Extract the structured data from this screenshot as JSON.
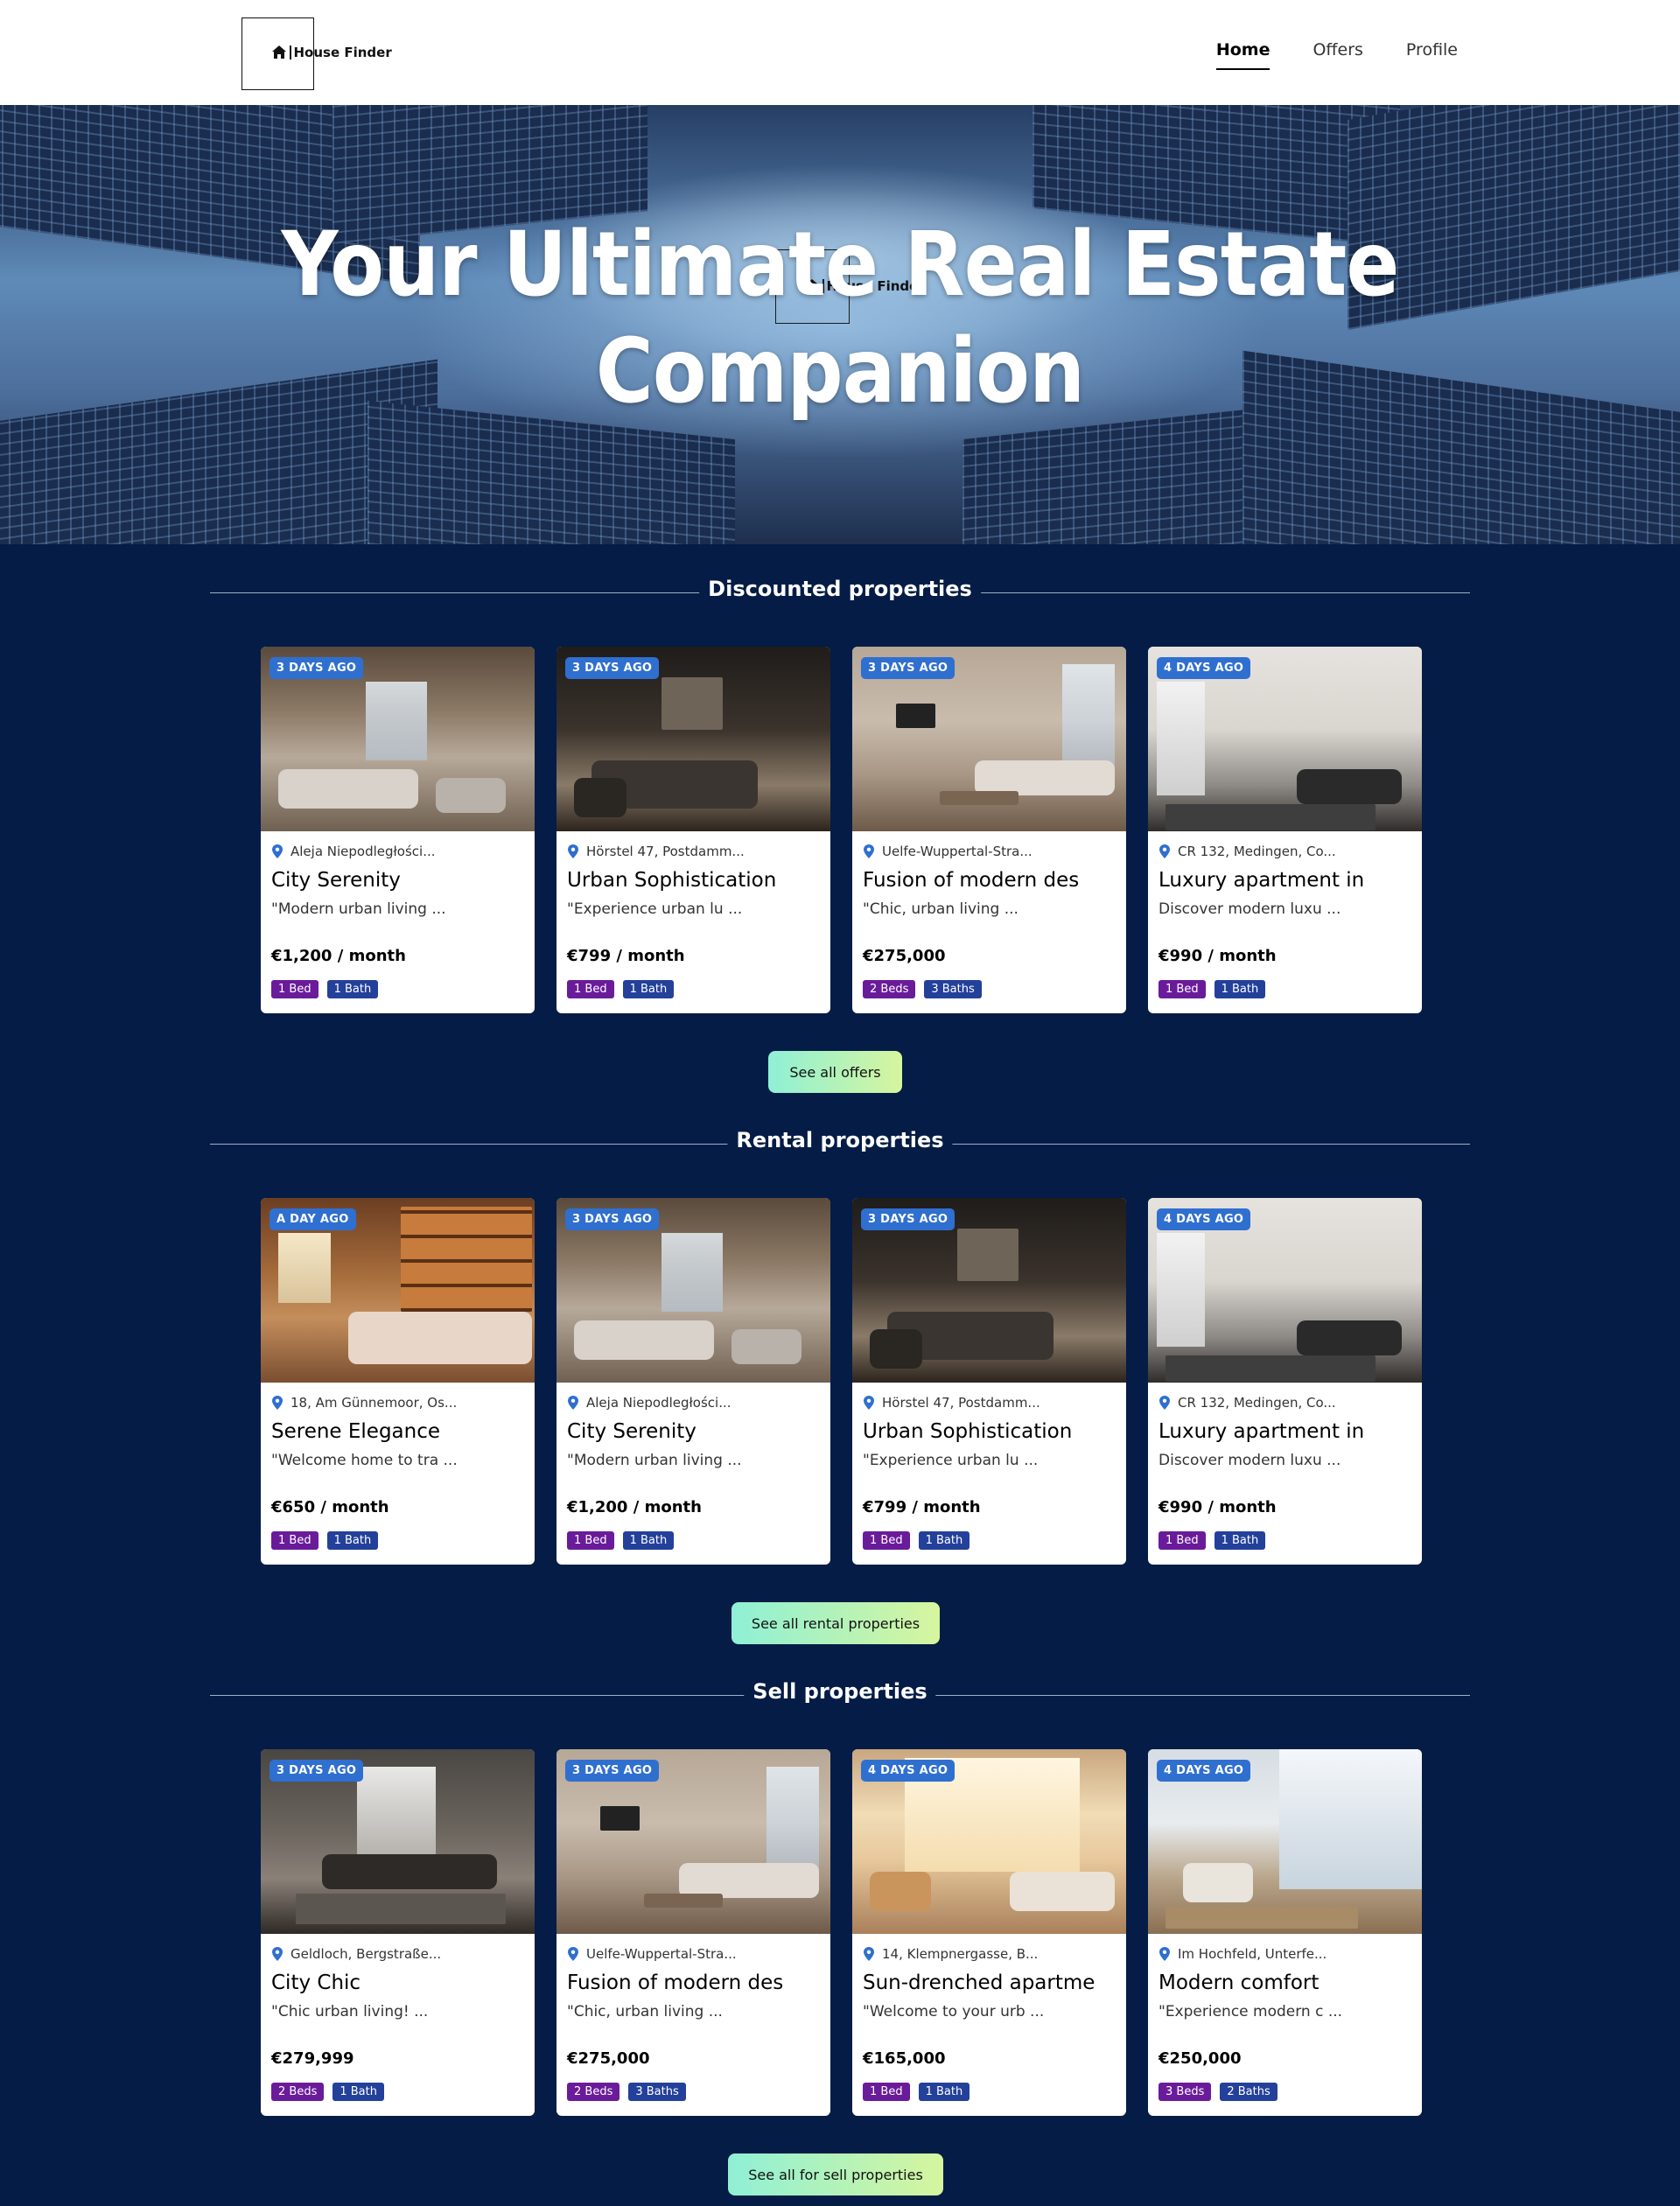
{
  "header": {
    "logo_text": "House Finder",
    "nav": [
      {
        "label": "Home",
        "active": true
      },
      {
        "label": "Offers",
        "active": false
      },
      {
        "label": "Profile",
        "active": false
      }
    ]
  },
  "hero": {
    "logo_text": "House Finder",
    "title": "Your Ultimate Real Estate Companion"
  },
  "sections": [
    {
      "title": "Discounted properties",
      "cta": "See all offers",
      "cards": [
        {
          "badge": "3 DAYS AGO",
          "location": "Aleja Niepodległości...",
          "name": "City Serenity",
          "desc": "\"Modern urban living ...",
          "price": "€1,200 / month",
          "beds": "1 Bed",
          "baths": "1 Bath",
          "scene": "bedroom1"
        },
        {
          "badge": "3 DAYS AGO",
          "location": "Hörstel 47, Postdamm...",
          "name": "Urban Sophistication",
          "desc": "\"Experience urban lu ...",
          "price": "€799 / month",
          "beds": "1 Bed",
          "baths": "1 Bath",
          "scene": "bedroom2"
        },
        {
          "badge": "3 DAYS AGO",
          "location": "Uelfe-Wuppertal-Stra...",
          "name": "Fusion of modern des",
          "desc": "\"Chic, urban living ...",
          "price": "€275,000",
          "beds": "2 Beds",
          "baths": "3 Baths",
          "scene": "living1"
        },
        {
          "badge": "4 DAYS AGO",
          "location": "CR 132, Medingen, Co...",
          "name": "Luxury apartment in",
          "desc": "Discover modern luxu ...",
          "price": "€990 / month",
          "beds": "1 Bed",
          "baths": "1 Bath",
          "scene": "living2"
        }
      ]
    },
    {
      "title": "Rental properties",
      "cta": "See all rental properties",
      "cards": [
        {
          "badge": "A DAY AGO",
          "location": "18, Am Günnemoor, Os...",
          "name": "Serene Elegance",
          "desc": "\"Welcome home to tra ...",
          "price": "€650 / month",
          "beds": "1 Bed",
          "baths": "1 Bath",
          "scene": "library"
        },
        {
          "badge": "3 DAYS AGO",
          "location": "Aleja Niepodległości...",
          "name": "City Serenity",
          "desc": "\"Modern urban living ...",
          "price": "€1,200 / month",
          "beds": "1 Bed",
          "baths": "1 Bath",
          "scene": "bedroom1"
        },
        {
          "badge": "3 DAYS AGO",
          "location": "Hörstel 47, Postdamm...",
          "name": "Urban Sophistication",
          "desc": "\"Experience urban lu ...",
          "price": "€799 / month",
          "beds": "1 Bed",
          "baths": "1 Bath",
          "scene": "bedroom2"
        },
        {
          "badge": "4 DAYS AGO",
          "location": "CR 132, Medingen, Co...",
          "name": "Luxury apartment in",
          "desc": "Discover modern luxu ...",
          "price": "€990 / month",
          "beds": "1 Bed",
          "baths": "1 Bath",
          "scene": "living2"
        }
      ]
    },
    {
      "title": "Sell properties",
      "cta": "See all for sell properties",
      "cards": [
        {
          "badge": "3 DAYS AGO",
          "location": "Geldloch, Bergstraße...",
          "name": "City Chic",
          "desc": "\"Chic urban living! ...",
          "price": "€279,999",
          "beds": "2 Beds",
          "baths": "1 Bath",
          "scene": "chic"
        },
        {
          "badge": "3 DAYS AGO",
          "location": "Uelfe-Wuppertal-Stra...",
          "name": "Fusion of modern des",
          "desc": "\"Chic, urban living ...",
          "price": "€275,000",
          "beds": "2 Beds",
          "baths": "3 Baths",
          "scene": "living1"
        },
        {
          "badge": "4 DAYS AGO",
          "location": "14, Klempnergasse, B...",
          "name": "Sun-drenched apartme",
          "desc": "\"Welcome to your urb ...",
          "price": "€165,000",
          "beds": "1 Bed",
          "baths": "1 Bath",
          "scene": "sunny"
        },
        {
          "badge": "4 DAYS AGO",
          "location": "Im Hochfeld, Unterfe...",
          "name": "Modern comfort",
          "desc": "\"Experience modern c ...",
          "price": "€250,000",
          "beds": "3 Beds",
          "baths": "2 Baths",
          "scene": "modern"
        }
      ]
    }
  ],
  "colors": {
    "page_bg": "#041c46",
    "badge": "#2f6fd0",
    "bed_tag": "#6a1b9a",
    "bath_tag": "#23409a",
    "cta_gradient_start": "#8ff0d6",
    "cta_gradient_end": "#d6f59e"
  },
  "icons": {
    "logo": "house-icon",
    "location": "location-pin-icon"
  }
}
